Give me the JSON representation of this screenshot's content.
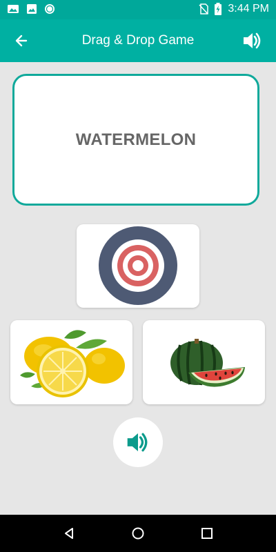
{
  "status": {
    "time": "3:44 PM",
    "icons": [
      "mail-notification-icon",
      "image-notification-icon",
      "sync-notification-icon",
      "no-sim-icon",
      "battery-charging-icon"
    ]
  },
  "app_bar": {
    "title": "Drag & Drop Game",
    "back_icon": "arrow-left-icon",
    "sound_icon": "speaker-icon"
  },
  "word_card": {
    "word": "WATERMELON"
  },
  "drop_target": {
    "icon": "target-icon"
  },
  "options": [
    {
      "item": "lemons-image"
    },
    {
      "item": "watermelon-image"
    }
  ],
  "play_button": {
    "icon": "speaker-icon"
  },
  "nav": {
    "back": "back-triangle-icon",
    "home": "home-circle-icon",
    "recent": "recent-square-icon"
  },
  "colors": {
    "teal": "#00b0a2",
    "teal_dark": "#00a89a",
    "background": "#e6e6e6",
    "word_text": "#666666"
  }
}
